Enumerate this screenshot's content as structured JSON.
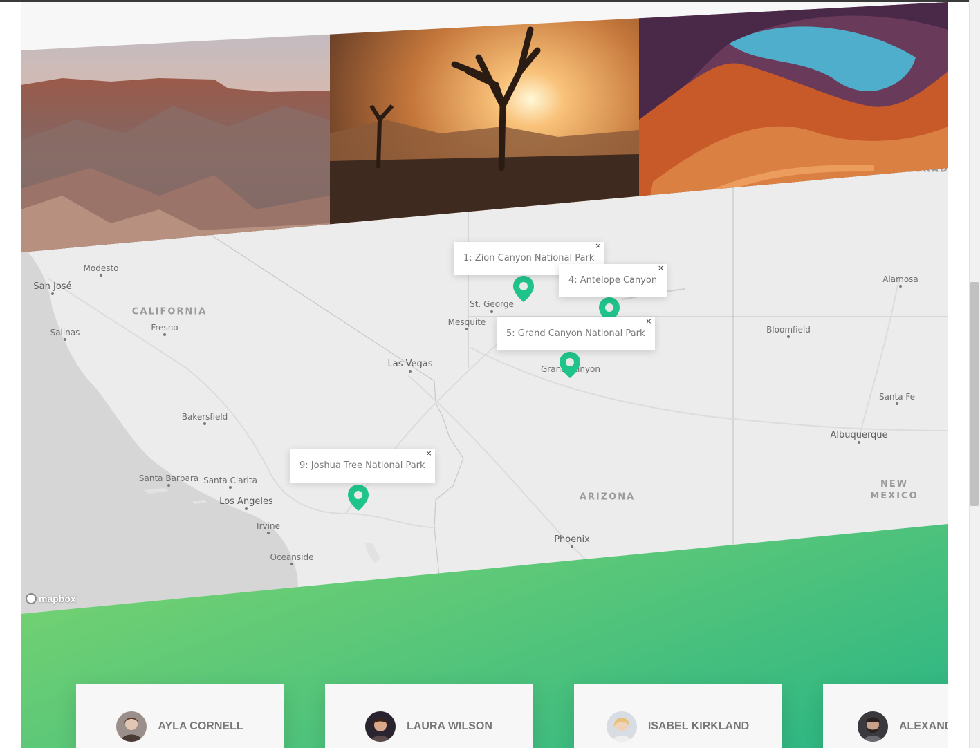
{
  "map": {
    "attribution": "mapbox",
    "cities": [
      {
        "label": "Modesto",
        "big": false
      },
      {
        "label": "San José",
        "big": true
      },
      {
        "label": "Fresno",
        "big": false
      },
      {
        "label": "Salinas",
        "big": false
      },
      {
        "label": "Bakersfield",
        "big": false
      },
      {
        "label": "Santa Barbara",
        "big": false
      },
      {
        "label": "Santa Clarita",
        "big": false
      },
      {
        "label": "Los Angeles",
        "big": true
      },
      {
        "label": "Irvine",
        "big": false
      },
      {
        "label": "Oceanside",
        "big": false
      },
      {
        "label": "Las Vegas",
        "big": true
      },
      {
        "label": "St. George",
        "big": false
      },
      {
        "label": "Mesquite",
        "big": false
      },
      {
        "label": "Grand Canyon",
        "big": false
      },
      {
        "label": "Phoenix",
        "big": true
      },
      {
        "label": "Alamosa",
        "big": false
      },
      {
        "label": "Bloomfield",
        "big": false
      },
      {
        "label": "Santa Fe",
        "big": false
      },
      {
        "label": "Albuquerque",
        "big": true
      }
    ],
    "states": [
      "CALIFORNIA",
      "ARIZONA",
      "NEW\nMEXICO",
      "COLORADO"
    ],
    "locations": [
      {
        "popup": "1: Zion Canyon National Park"
      },
      {
        "popup": "4: Antelope Canyon"
      },
      {
        "popup": "5: Grand Canyon National Park"
      },
      {
        "popup": "9: Joshua Tree National Park"
      }
    ],
    "close_symbol": "×"
  },
  "photos": [
    {
      "name": "grand-canyon-photo"
    },
    {
      "name": "joshua-tree-photo"
    },
    {
      "name": "antelope-canyon-photo"
    }
  ],
  "reviews": [
    {
      "name": "AYLA CORNELL"
    },
    {
      "name": "LAURA WILSON"
    },
    {
      "name": "ISABEL KIRKLAND"
    },
    {
      "name": "ALEXANDER JONES"
    }
  ],
  "colors": {
    "accent": "#55c57a",
    "pin": "#1fc48a"
  }
}
